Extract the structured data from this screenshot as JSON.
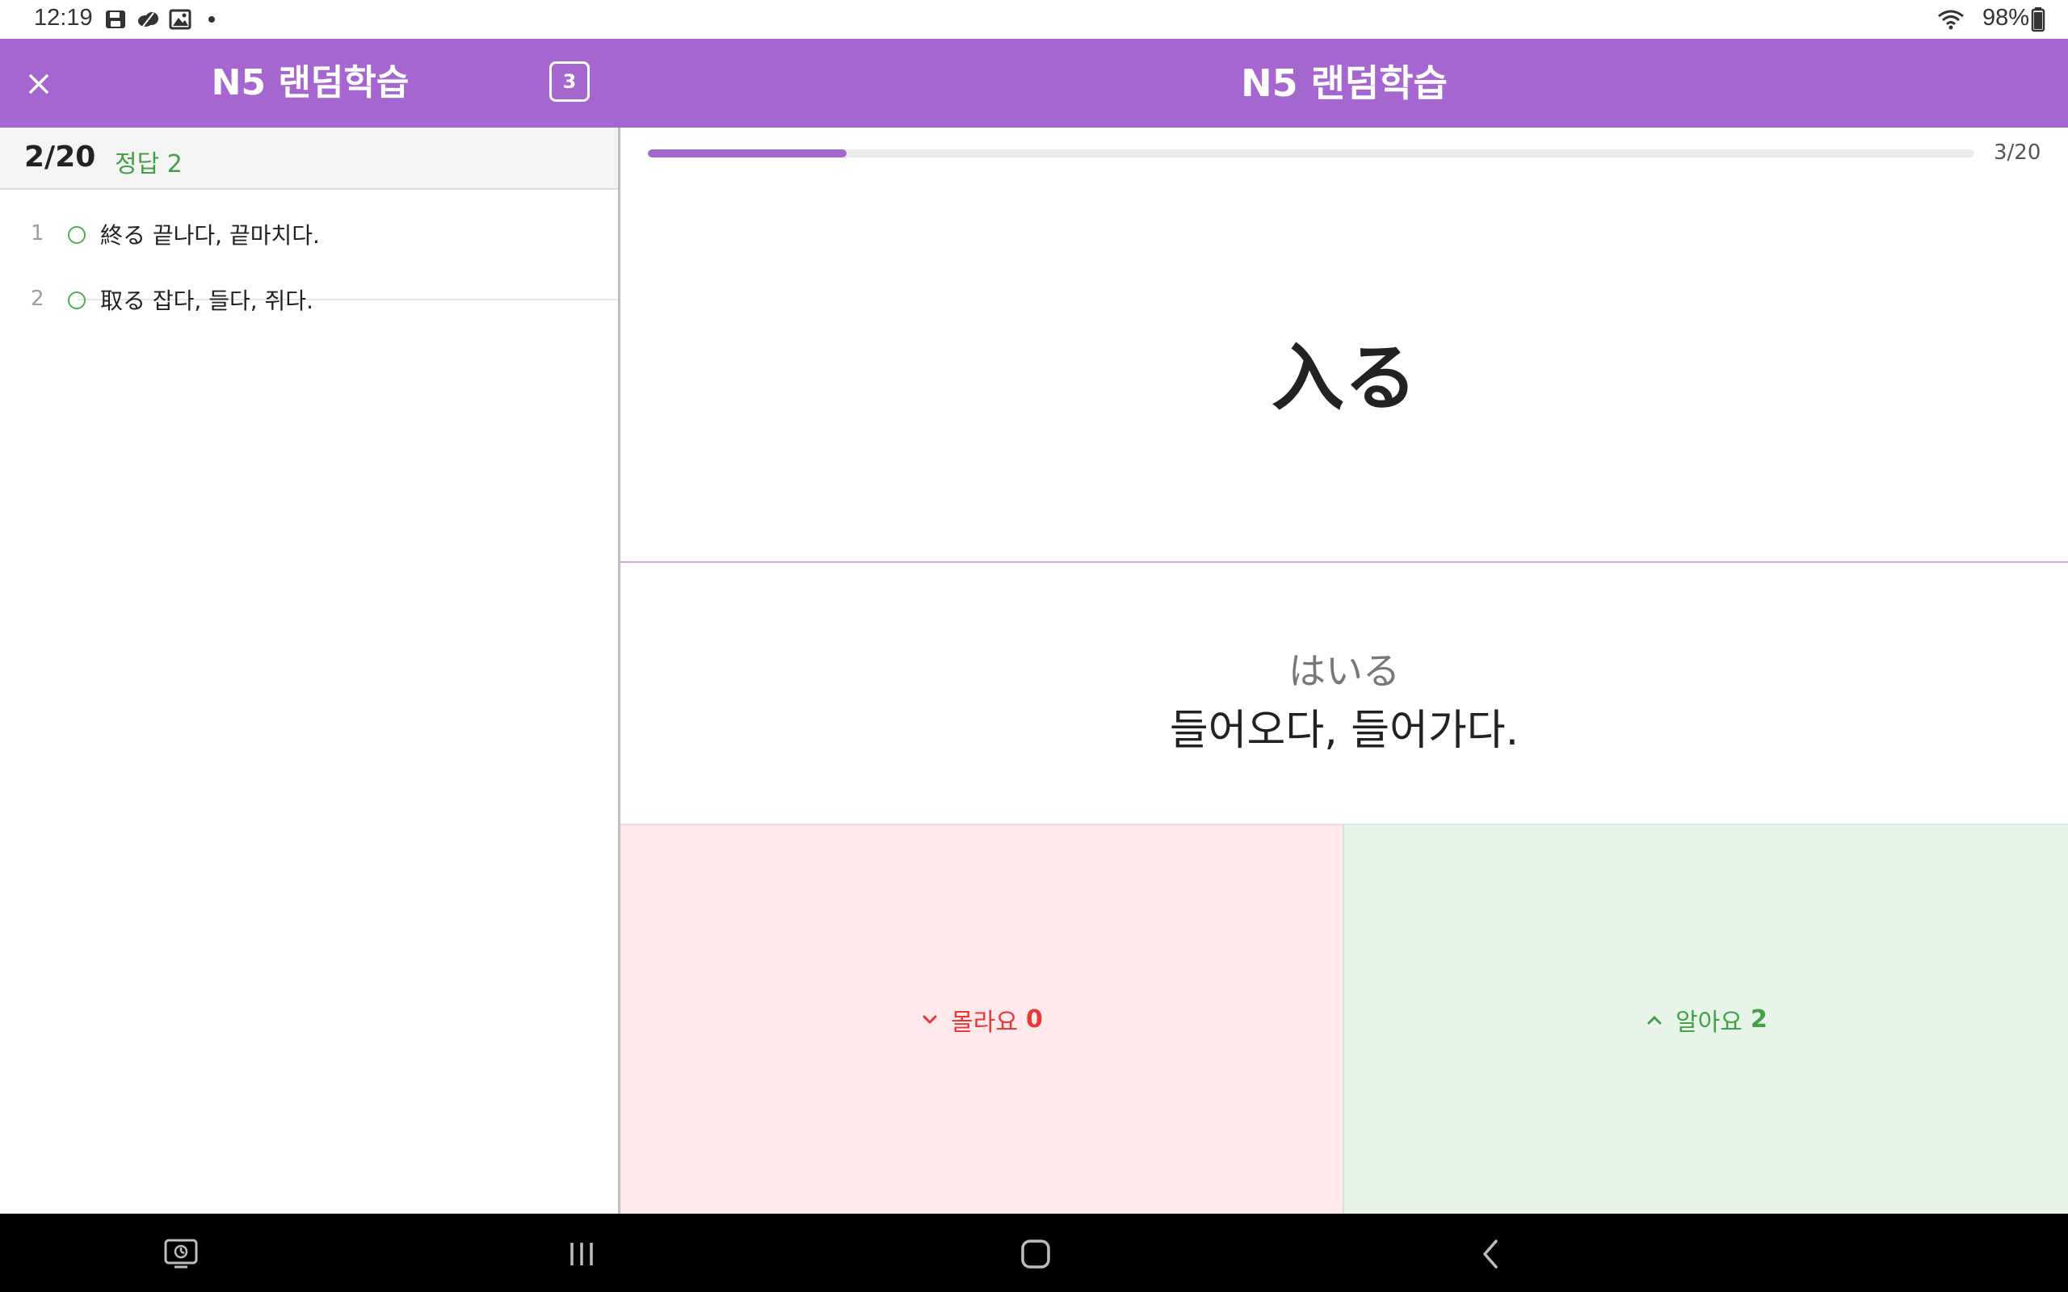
{
  "status_bar": {
    "time": "12:19",
    "battery": "98%",
    "icons": [
      "save-icon",
      "cloud-icon",
      "image-icon",
      "dot-icon",
      "wifi-icon",
      "battery-icon"
    ]
  },
  "left_panel": {
    "title": "N5 랜덤학습",
    "badge": "3",
    "summary_count": "2/20",
    "summary_correct": "정답 2",
    "items": [
      {
        "num": "1",
        "text": "終る 끝나다, 끝마치다."
      },
      {
        "num": "2",
        "text": "取る 잡다, 들다, 쥐다."
      }
    ]
  },
  "right_panel": {
    "title": "N5 랜덤학습",
    "progress_label": "3/20",
    "progress_value": 0.15,
    "word": "入る",
    "reading": "はいる",
    "meaning": "들어오다, 들어가다.",
    "dont_know_label": "몰라요",
    "dont_know_count": "0",
    "know_label": "알아요",
    "know_count": "2"
  },
  "colors": {
    "accent": "#a666d0",
    "correct": "#43a047",
    "wrong": "#e53935",
    "dont_know_bg": "#ffe9ec",
    "know_bg": "#e7f5e8"
  }
}
